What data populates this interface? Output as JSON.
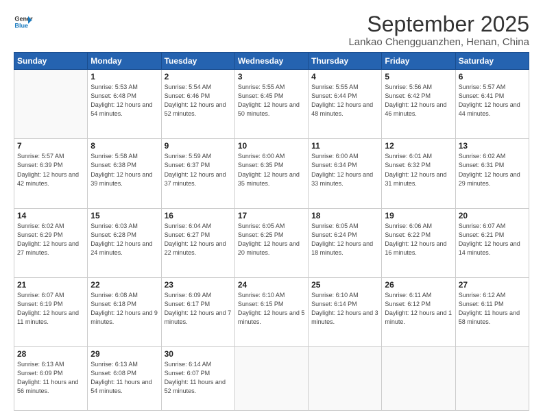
{
  "header": {
    "logo_line1": "General",
    "logo_line2": "Blue",
    "month_title": "September 2025",
    "subtitle": "Lankao Chengguanzhen, Henan, China"
  },
  "weekdays": [
    "Sunday",
    "Monday",
    "Tuesday",
    "Wednesday",
    "Thursday",
    "Friday",
    "Saturday"
  ],
  "weeks": [
    [
      {
        "day": null
      },
      {
        "day": "1",
        "sunrise": "5:53 AM",
        "sunset": "6:48 PM",
        "daylight": "12 hours and 54 minutes."
      },
      {
        "day": "2",
        "sunrise": "5:54 AM",
        "sunset": "6:46 PM",
        "daylight": "12 hours and 52 minutes."
      },
      {
        "day": "3",
        "sunrise": "5:55 AM",
        "sunset": "6:45 PM",
        "daylight": "12 hours and 50 minutes."
      },
      {
        "day": "4",
        "sunrise": "5:55 AM",
        "sunset": "6:44 PM",
        "daylight": "12 hours and 48 minutes."
      },
      {
        "day": "5",
        "sunrise": "5:56 AM",
        "sunset": "6:42 PM",
        "daylight": "12 hours and 46 minutes."
      },
      {
        "day": "6",
        "sunrise": "5:57 AM",
        "sunset": "6:41 PM",
        "daylight": "12 hours and 44 minutes."
      }
    ],
    [
      {
        "day": "7",
        "sunrise": "5:57 AM",
        "sunset": "6:39 PM",
        "daylight": "12 hours and 42 minutes."
      },
      {
        "day": "8",
        "sunrise": "5:58 AM",
        "sunset": "6:38 PM",
        "daylight": "12 hours and 39 minutes."
      },
      {
        "day": "9",
        "sunrise": "5:59 AM",
        "sunset": "6:37 PM",
        "daylight": "12 hours and 37 minutes."
      },
      {
        "day": "10",
        "sunrise": "6:00 AM",
        "sunset": "6:35 PM",
        "daylight": "12 hours and 35 minutes."
      },
      {
        "day": "11",
        "sunrise": "6:00 AM",
        "sunset": "6:34 PM",
        "daylight": "12 hours and 33 minutes."
      },
      {
        "day": "12",
        "sunrise": "6:01 AM",
        "sunset": "6:32 PM",
        "daylight": "12 hours and 31 minutes."
      },
      {
        "day": "13",
        "sunrise": "6:02 AM",
        "sunset": "6:31 PM",
        "daylight": "12 hours and 29 minutes."
      }
    ],
    [
      {
        "day": "14",
        "sunrise": "6:02 AM",
        "sunset": "6:29 PM",
        "daylight": "12 hours and 27 minutes."
      },
      {
        "day": "15",
        "sunrise": "6:03 AM",
        "sunset": "6:28 PM",
        "daylight": "12 hours and 24 minutes."
      },
      {
        "day": "16",
        "sunrise": "6:04 AM",
        "sunset": "6:27 PM",
        "daylight": "12 hours and 22 minutes."
      },
      {
        "day": "17",
        "sunrise": "6:05 AM",
        "sunset": "6:25 PM",
        "daylight": "12 hours and 20 minutes."
      },
      {
        "day": "18",
        "sunrise": "6:05 AM",
        "sunset": "6:24 PM",
        "daylight": "12 hours and 18 minutes."
      },
      {
        "day": "19",
        "sunrise": "6:06 AM",
        "sunset": "6:22 PM",
        "daylight": "12 hours and 16 minutes."
      },
      {
        "day": "20",
        "sunrise": "6:07 AM",
        "sunset": "6:21 PM",
        "daylight": "12 hours and 14 minutes."
      }
    ],
    [
      {
        "day": "21",
        "sunrise": "6:07 AM",
        "sunset": "6:19 PM",
        "daylight": "12 hours and 11 minutes."
      },
      {
        "day": "22",
        "sunrise": "6:08 AM",
        "sunset": "6:18 PM",
        "daylight": "12 hours and 9 minutes."
      },
      {
        "day": "23",
        "sunrise": "6:09 AM",
        "sunset": "6:17 PM",
        "daylight": "12 hours and 7 minutes."
      },
      {
        "day": "24",
        "sunrise": "6:10 AM",
        "sunset": "6:15 PM",
        "daylight": "12 hours and 5 minutes."
      },
      {
        "day": "25",
        "sunrise": "6:10 AM",
        "sunset": "6:14 PM",
        "daylight": "12 hours and 3 minutes."
      },
      {
        "day": "26",
        "sunrise": "6:11 AM",
        "sunset": "6:12 PM",
        "daylight": "12 hours and 1 minute."
      },
      {
        "day": "27",
        "sunrise": "6:12 AM",
        "sunset": "6:11 PM",
        "daylight": "11 hours and 58 minutes."
      }
    ],
    [
      {
        "day": "28",
        "sunrise": "6:13 AM",
        "sunset": "6:09 PM",
        "daylight": "11 hours and 56 minutes."
      },
      {
        "day": "29",
        "sunrise": "6:13 AM",
        "sunset": "6:08 PM",
        "daylight": "11 hours and 54 minutes."
      },
      {
        "day": "30",
        "sunrise": "6:14 AM",
        "sunset": "6:07 PM",
        "daylight": "11 hours and 52 minutes."
      },
      {
        "day": null
      },
      {
        "day": null
      },
      {
        "day": null
      },
      {
        "day": null
      }
    ]
  ]
}
